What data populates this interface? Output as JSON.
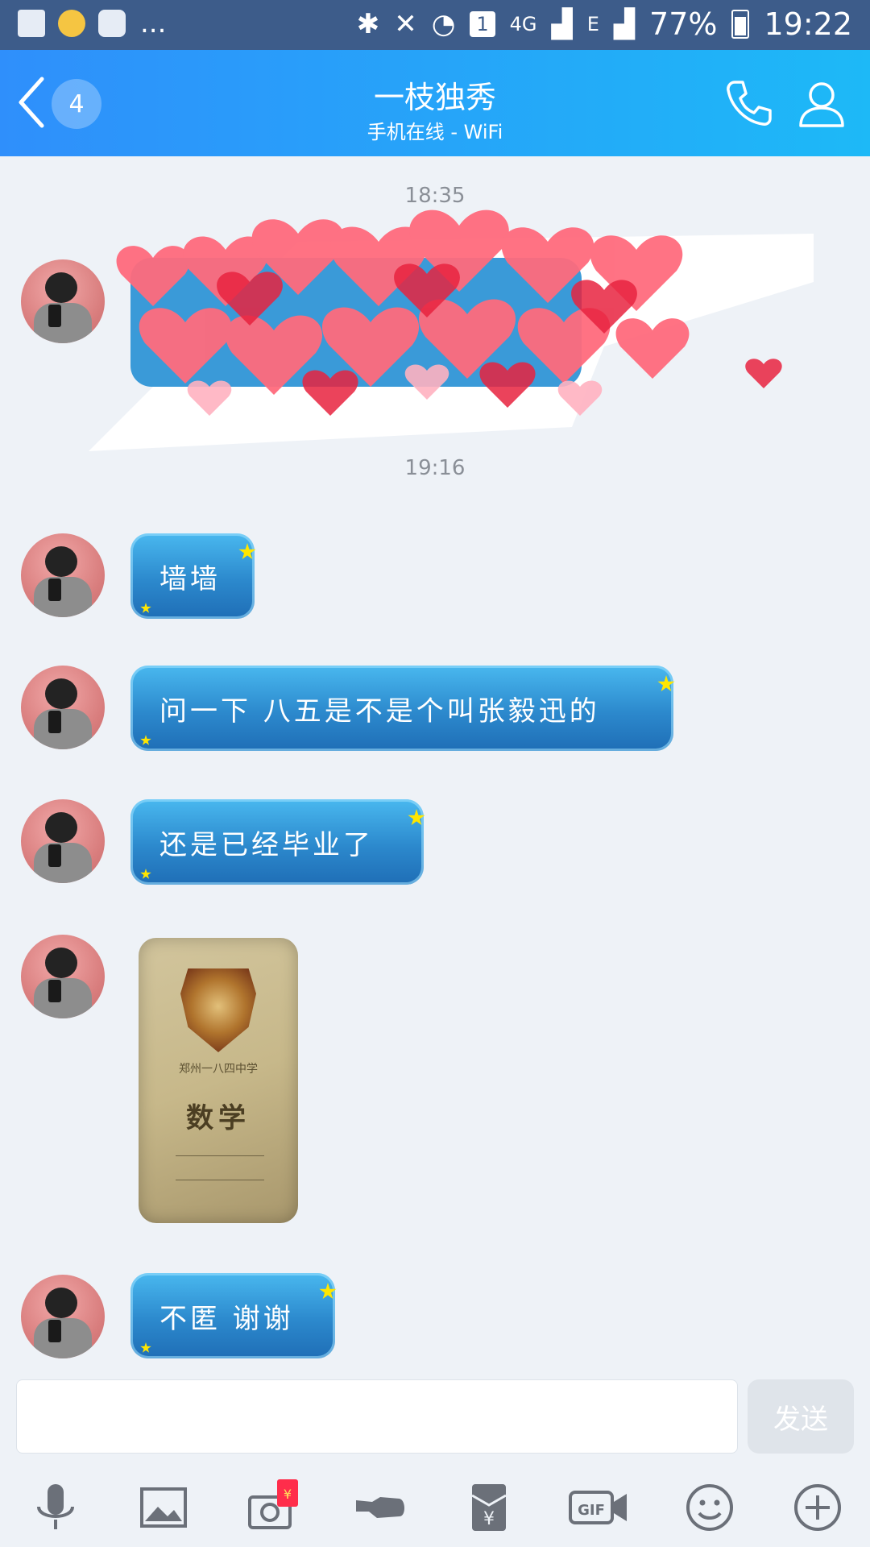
{
  "status_bar": {
    "battery": "77%",
    "time": "19:22",
    "sim_slot": "1",
    "network_4g": "4G",
    "network_e": "E",
    "notification_overflow": "...",
    "icons": [
      "gallery-icon",
      "award-icon",
      "chat-icon",
      "bluetooth-icon",
      "mute-icon",
      "wifi-icon",
      "signal-icon",
      "battery-icon"
    ]
  },
  "header": {
    "unread_count": "4",
    "contact_name": "一枝独秀",
    "presence": "手机在线 - WiFi",
    "accent_gradient": [
      "#2f8ffb",
      "#1db9f7"
    ]
  },
  "messages": {
    "times": [
      "18:35",
      "19:16"
    ],
    "texts": [
      "墙墙",
      "问一下 八五是不是个叫张毅迅的",
      "还是已经毕业了",
      "不匿 谢谢"
    ]
  },
  "photo": {
    "school": "郑州一八四中学",
    "subject": "数学"
  },
  "composer": {
    "value": "",
    "send_label": "发送"
  },
  "toolbar": {
    "items": [
      "microphone-icon",
      "image-icon",
      "camera-redpacket-icon",
      "poke-icon",
      "red-packet-icon",
      "gif-icon",
      "emoji-icon",
      "plus-icon"
    ],
    "gif_label": "GIF",
    "redpacket_label": "¥"
  },
  "colors": {
    "bubble_top": "#49b8ef",
    "bubble_bottom": "#1f6eb6",
    "chat_bg": "#eef2f7",
    "send_disabled": "#dfe4ea"
  }
}
